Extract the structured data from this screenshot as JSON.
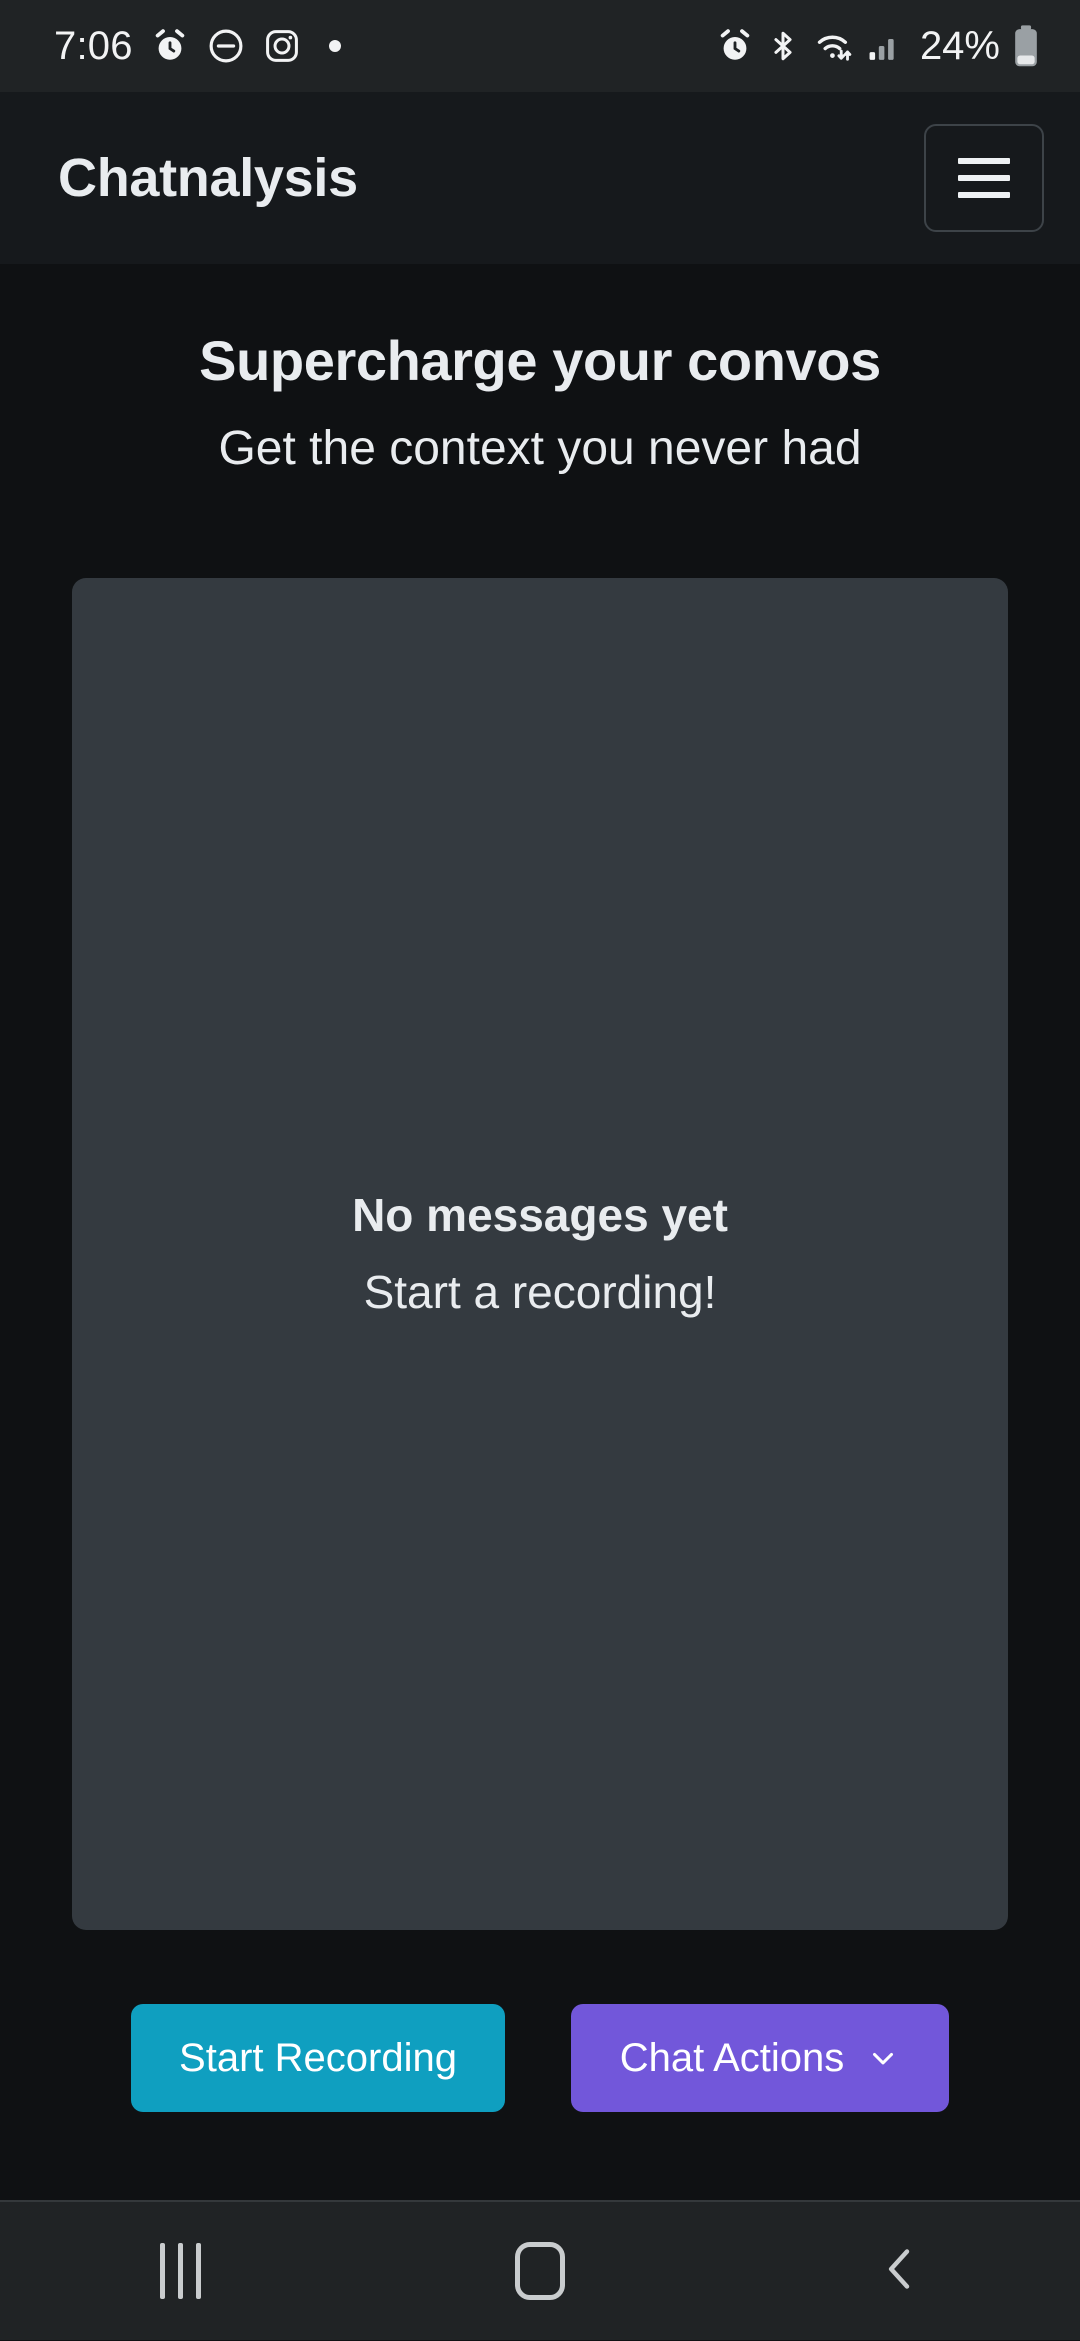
{
  "status_bar": {
    "time": "7:06",
    "battery_percent": "24%",
    "left_icons": [
      "alarm-clock-icon",
      "do-not-disturb-icon",
      "instagram-icon",
      "notification-dot-icon"
    ],
    "right_icons": [
      "alarm-clock-icon",
      "bluetooth-icon",
      "wifi-icon",
      "cellular-signal-icon",
      "battery-icon"
    ],
    "background": "#202325"
  },
  "app_bar": {
    "title": "Chatnalysis",
    "menu_icon": "hamburger-menu-icon",
    "background": "#16191c"
  },
  "hero": {
    "title": "Supercharge your convos",
    "subtitle": "Get the context you never had"
  },
  "message_card": {
    "empty_title": "No messages yet",
    "empty_subtitle": "Start a recording!",
    "background": "#343a40"
  },
  "actions": {
    "start_recording_label": "Start Recording",
    "start_recording_color": "#0f9fc0",
    "chat_actions_label": "Chat Actions",
    "chat_actions_color": "#7257da",
    "chat_actions_icon": "chevron-down-icon"
  },
  "nav_bar": {
    "recents_icon": "recents-icon",
    "home_icon": "home-icon",
    "back_icon": "back-chevron-icon",
    "background": "#202325"
  },
  "theme": {
    "page_background": "#1a1d20",
    "text_primary": "#e9ecef"
  }
}
